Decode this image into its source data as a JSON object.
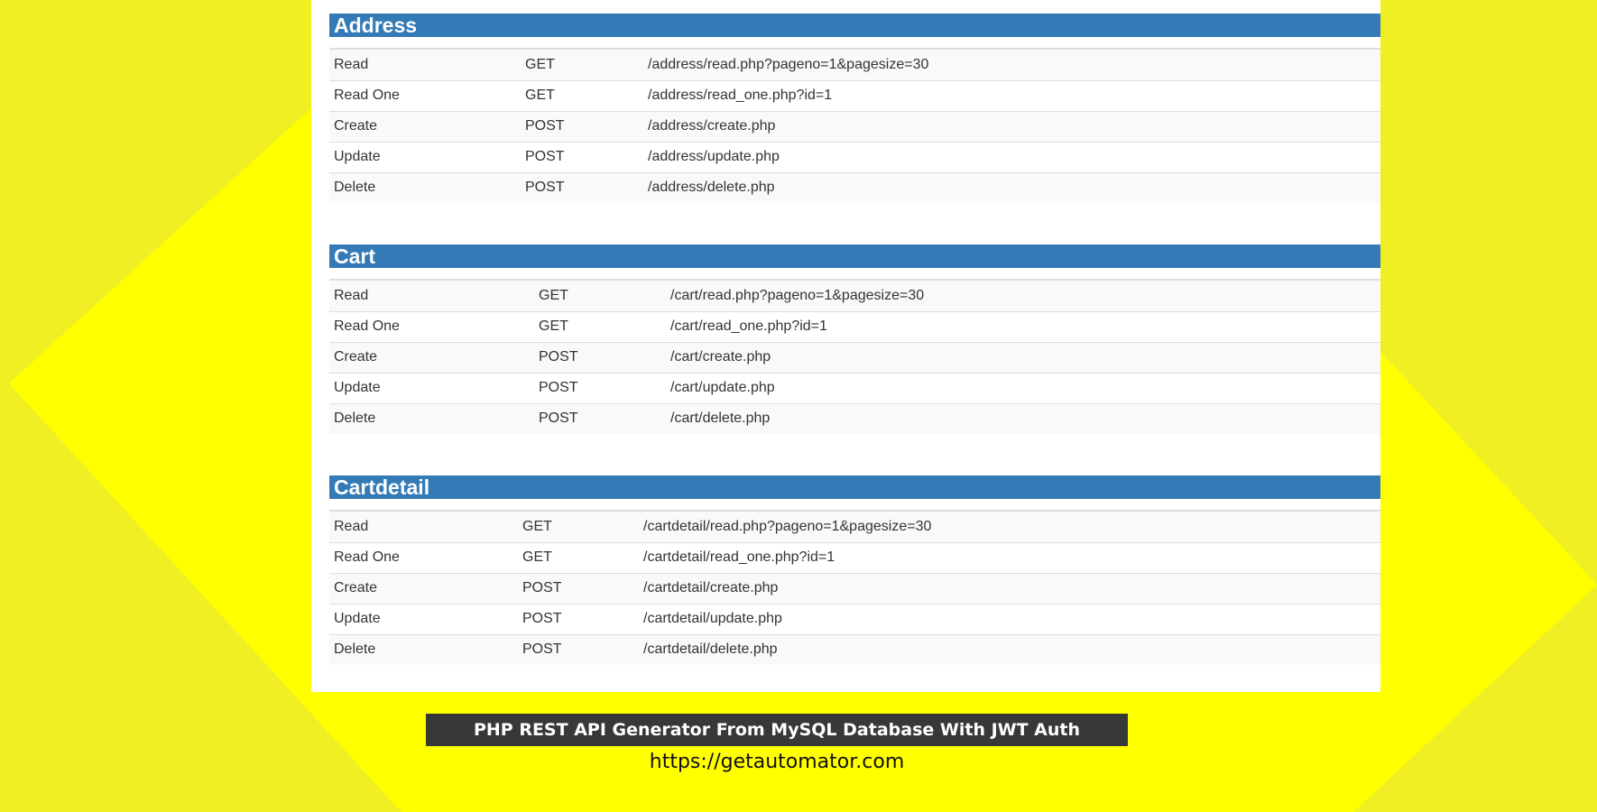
{
  "colors": {
    "background": "#f0ef24",
    "background_shape": "#ffff00",
    "section_header": "#337ab7",
    "banner": "#383838"
  },
  "sections": [
    {
      "title": "Address",
      "rows": [
        {
          "action": "Read",
          "method": "GET",
          "endpoint": "/address/read.php?pageno=1&pagesize=30"
        },
        {
          "action": "Read One",
          "method": "GET",
          "endpoint": "/address/read_one.php?id=1"
        },
        {
          "action": "Create",
          "method": "POST",
          "endpoint": "/address/create.php"
        },
        {
          "action": "Update",
          "method": "POST",
          "endpoint": "/address/update.php"
        },
        {
          "action": "Delete",
          "method": "POST",
          "endpoint": "/address/delete.php"
        }
      ]
    },
    {
      "title": "Cart",
      "rows": [
        {
          "action": "Read",
          "method": "GET",
          "endpoint": "/cart/read.php?pageno=1&pagesize=30"
        },
        {
          "action": "Read One",
          "method": "GET",
          "endpoint": "/cart/read_one.php?id=1"
        },
        {
          "action": "Create",
          "method": "POST",
          "endpoint": "/cart/create.php"
        },
        {
          "action": "Update",
          "method": "POST",
          "endpoint": "/cart/update.php"
        },
        {
          "action": "Delete",
          "method": "POST",
          "endpoint": "/cart/delete.php"
        }
      ]
    },
    {
      "title": "Cartdetail",
      "rows": [
        {
          "action": "Read",
          "method": "GET",
          "endpoint": "/cartdetail/read.php?pageno=1&pagesize=30"
        },
        {
          "action": "Read One",
          "method": "GET",
          "endpoint": "/cartdetail/read_one.php?id=1"
        },
        {
          "action": "Create",
          "method": "POST",
          "endpoint": "/cartdetail/create.php"
        },
        {
          "action": "Update",
          "method": "POST",
          "endpoint": "/cartdetail/update.php"
        },
        {
          "action": "Delete",
          "method": "POST",
          "endpoint": "/cartdetail/delete.php"
        }
      ]
    }
  ],
  "banner": {
    "title": "PHP REST API Generator From MySQL Database With JWT Auth",
    "url": "https://getautomator.com"
  }
}
